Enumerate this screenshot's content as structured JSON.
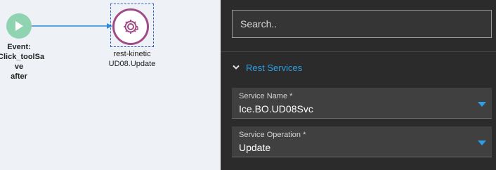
{
  "canvas": {
    "event_node": {
      "icon": "play-icon",
      "color": "#8fd3b1",
      "label_lines": [
        "Event:",
        "aClick_toolSa",
        "ve",
        "after"
      ]
    },
    "rest_node": {
      "icon": "gear-sync-icon",
      "border_color": "#a04c86",
      "label_lines": [
        "rest-kinetic",
        "UD08.Update"
      ]
    },
    "connector_color": "#2f8bd8"
  },
  "panel": {
    "search": {
      "placeholder": "Search.."
    },
    "section": {
      "title": "Rest Services",
      "icon": "chevron-down-icon",
      "accent": "#2e9fe6"
    },
    "fields": [
      {
        "label": "Service Name *",
        "value": "Ice.BO.UD08Svc",
        "icon": "dropdown-caret-icon"
      },
      {
        "label": "Service Operation *",
        "value": "Update",
        "icon": "dropdown-caret-icon"
      }
    ]
  }
}
